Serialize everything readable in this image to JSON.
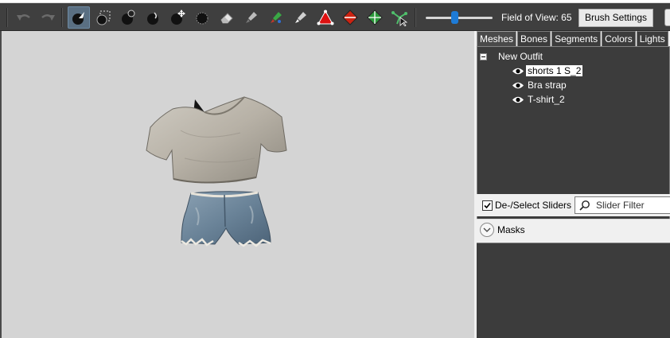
{
  "toolbar": {
    "buttons": [
      {
        "name": "undo-button",
        "icon": "undo-icon"
      },
      {
        "name": "redo-button",
        "icon": "redo-icon"
      },
      {
        "name": "select-tool-button",
        "icon": "select-arrow-icon",
        "active": true
      },
      {
        "name": "mask-brush-button",
        "icon": "mask-brush-icon"
      },
      {
        "name": "inflate-brush-button",
        "icon": "inflate-brush-icon"
      },
      {
        "name": "deflate-brush-button",
        "icon": "deflate-brush-icon"
      },
      {
        "name": "move-brush-button",
        "icon": "move-brush-icon"
      },
      {
        "name": "smooth-brush-button",
        "icon": "smooth-brush-icon"
      },
      {
        "name": "erase-brush-button",
        "icon": "eraser-icon"
      },
      {
        "name": "weight-brush-button",
        "icon": "weight-brush-icon"
      },
      {
        "name": "color-brush-button",
        "icon": "color-brush-icon"
      },
      {
        "name": "alpha-brush-button",
        "icon": "alpha-brush-icon"
      },
      {
        "name": "collapse-vertex-button",
        "icon": "collapse-vertex-icon"
      },
      {
        "name": "flip-edge-button",
        "icon": "flip-edge-icon"
      },
      {
        "name": "split-edge-button",
        "icon": "split-edge-icon"
      },
      {
        "name": "move-vertex-button",
        "icon": "move-vertex-icon"
      }
    ],
    "field_of_view_label": "Field of View: 65",
    "field_of_view_fraction": 0.43,
    "brush_settings_label": "Brush Settings"
  },
  "panel": {
    "tabs": [
      "Meshes",
      "Bones",
      "Segments",
      "Colors",
      "Lights"
    ],
    "active_tab": "Meshes",
    "tree": {
      "root": "New Outfit",
      "items": [
        {
          "label": "shorts 1 S_2",
          "selected": true,
          "icon": "eye-icon"
        },
        {
          "label": "Bra strap",
          "selected": false,
          "icon": "eye-icon"
        },
        {
          "label": "T-shirt_2",
          "selected": false,
          "icon": "eye-icon"
        }
      ]
    },
    "sliders": {
      "deselect_label": "De-/Select Sliders",
      "deselect_checked": true,
      "filter_placeholder": "Slider Filter",
      "masks_label": "Masks"
    }
  },
  "colors": {
    "toolbar_bg": "#3f3f3f",
    "viewport_bg": "#d4d4d4",
    "tree_bg": "#3c3c3c",
    "accent": "#1e7bd6"
  }
}
